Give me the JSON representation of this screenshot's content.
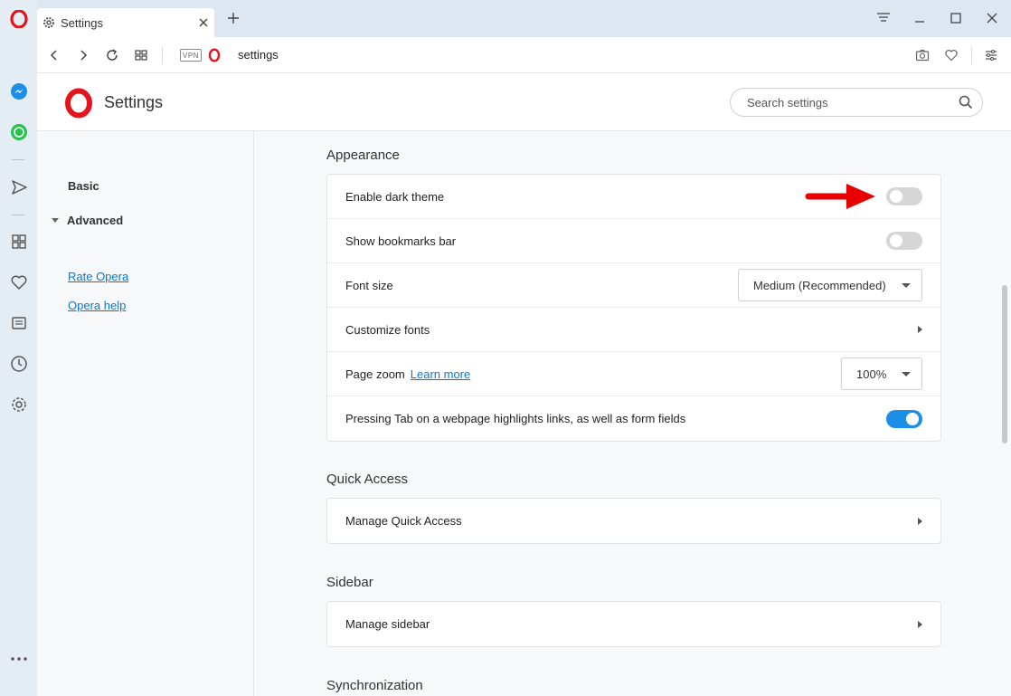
{
  "browser": {
    "tab_title": "Settings",
    "url": "settings",
    "vpn_label": "VPN"
  },
  "page": {
    "title": "Settings",
    "search_placeholder": "Search settings"
  },
  "nav": {
    "basic": "Basic",
    "advanced": "Advanced",
    "rate": "Rate Opera",
    "help": "Opera help"
  },
  "sections": {
    "appearance": {
      "title": "Appearance",
      "dark_theme": "Enable dark theme",
      "dark_theme_on": false,
      "bookmarks_bar": "Show bookmarks bar",
      "bookmarks_bar_on": false,
      "font_size": "Font size",
      "font_size_value": "Medium (Recommended)",
      "customize_fonts": "Customize fonts",
      "page_zoom": "Page zoom",
      "learn_more": "Learn more",
      "page_zoom_value": "100%",
      "tab_highlight": "Pressing Tab on a webpage highlights links, as well as form fields",
      "tab_highlight_on": true
    },
    "quick_access": {
      "title": "Quick Access",
      "manage": "Manage Quick Access"
    },
    "sidebar": {
      "title": "Sidebar",
      "manage": "Manage sidebar"
    },
    "sync": {
      "title": "Synchronization"
    }
  },
  "colors": {
    "accent": "#1b8fe6",
    "opera_red": "#e3141c",
    "arrow_red": "#e60000"
  }
}
